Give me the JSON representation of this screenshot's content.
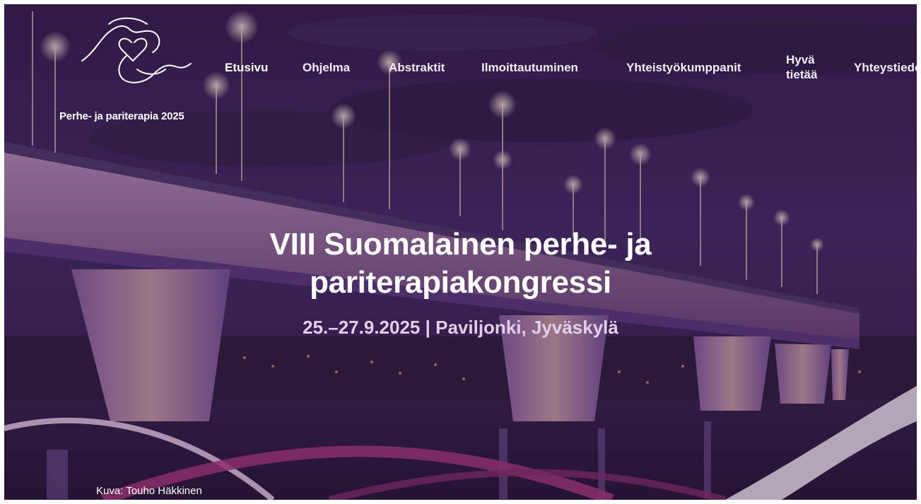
{
  "brand": {
    "name": "Perhe- ja pariterapia 2025"
  },
  "nav": {
    "items": [
      {
        "label": "Etusivu",
        "active": true
      },
      {
        "label": "Ohjelma"
      },
      {
        "label": "Abstraktit"
      },
      {
        "label": "Ilmoittautuminen"
      },
      {
        "label": "Yhteistyökumppanit"
      },
      {
        "label": "Hyvä tietää"
      },
      {
        "label": "Yhteystiedot"
      }
    ]
  },
  "hero": {
    "title_line1": "VIII Suomalainen perhe- ja",
    "title_line2": "pariterapiakongressi",
    "subtitle": "25.–27.9.2025 | Paviljonki, Jyväskylä"
  },
  "photo_credit": "Kuva: Touho Häkkinen",
  "colors": {
    "overlay": "#3a1446",
    "wave_pink": "#b8407e",
    "wave_light": "#f0dff2",
    "bridge_light": "#a98bd6"
  }
}
